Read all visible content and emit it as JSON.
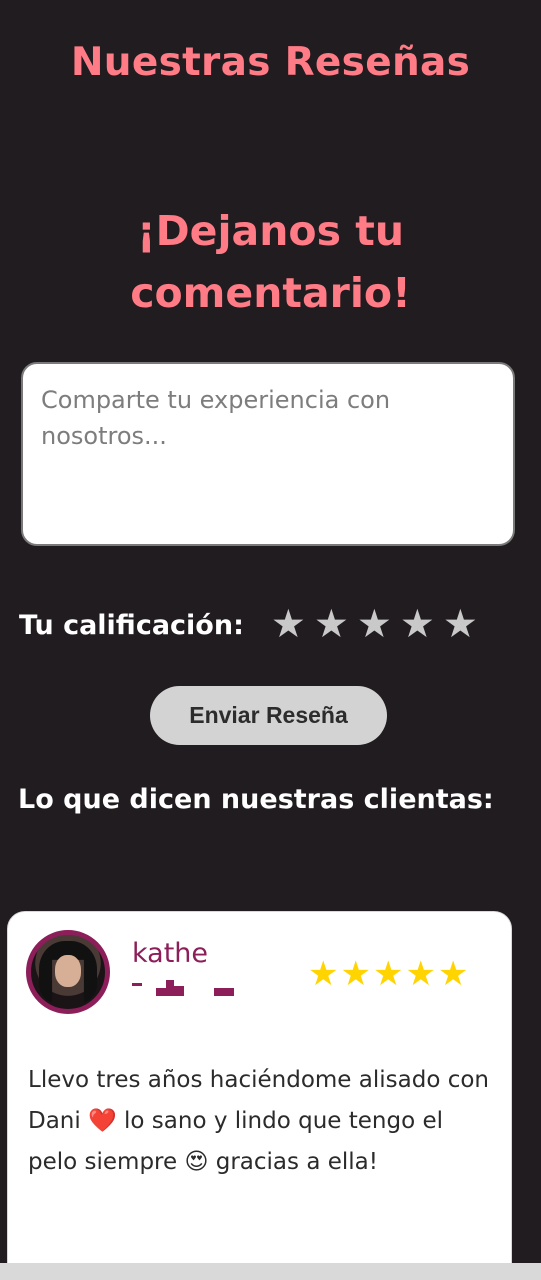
{
  "header": {
    "title": "Nuestras Reseñas"
  },
  "form": {
    "cta": "¡Dejanos tu comentario!",
    "placeholder": "Comparte tu experiencia con nosotros...",
    "rating_label": "Tu calificación:",
    "rating_stars": [
      "★",
      "★",
      "★",
      "★",
      "★"
    ],
    "rating_value": 0,
    "submit_label": "Enviar Reseña"
  },
  "reviews_section": {
    "title": "Lo que dicen nuestras clientas:",
    "reviews": [
      {
        "name": "kathe",
        "stars": "★★★★★",
        "rating": 5,
        "text": "Llevo tres años haciéndome alisado con Dani ❤️ lo sano y lindo que tengo el pelo siempre 😍 gracias a ella!"
      }
    ]
  },
  "colors": {
    "background": "#211c20",
    "accent_pink": "#ff7b86",
    "reviewer_magenta": "#8c1e5a",
    "star_gold": "#ffd400",
    "star_empty": "#c9c9c9"
  },
  "icons": {
    "rating_star": "star-icon",
    "avatar": "user-avatar"
  }
}
